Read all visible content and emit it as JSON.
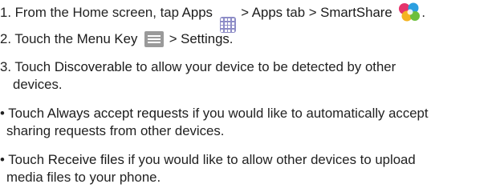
{
  "step1": {
    "number": "1.",
    "text_a": "From the Home screen, tap ",
    "apps": "Apps",
    "sep_a": " > ",
    "apps_tab": "Apps",
    "text_b": " tab > ",
    "smartshare": "SmartShare"
  },
  "step2": {
    "number": "2.",
    "text_a": "Touch the ",
    "menu_key": "Menu Key",
    "sep": " > ",
    "settings": "Settings",
    "end": "."
  },
  "step3": {
    "number": "3.",
    "text_a": "Touch ",
    "discoverable": "Discoverable",
    "text_b": " to allow your device to be detected by other",
    "line2": "devices."
  },
  "bullet1": {
    "marker": "•",
    "text_a": "Touch ",
    "option": "Always accept requests",
    "text_b": " if you would like to automatically accept",
    "line2": "sharing requests from other devices."
  },
  "bullet2": {
    "marker": "•",
    "text_a": "Touch ",
    "option": "Receive files",
    "text_b": " if you would like to allow other devices to upload",
    "line2": "media files to your phone."
  },
  "icons": {
    "apps": "apps-grid-icon",
    "smartshare": "smartshare-icon",
    "menu": "menu-key-icon"
  }
}
